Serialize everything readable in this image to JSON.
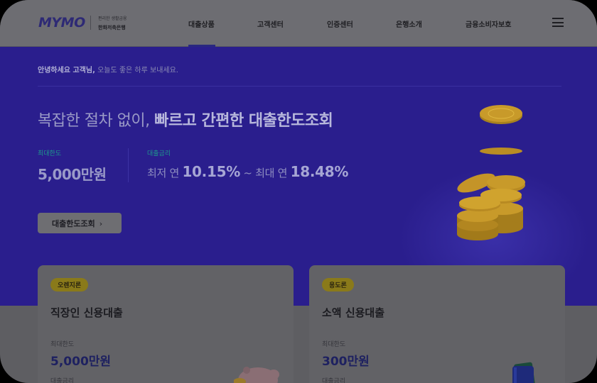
{
  "brand": {
    "logo": "MYMO",
    "sub_line1": "편리한 생활금융",
    "sub_line2": "한화저축은행"
  },
  "nav": {
    "items": [
      "대출상품",
      "고객센터",
      "인증센터",
      "은행소개",
      "금융소비자보호"
    ],
    "active": "대출상품"
  },
  "hero": {
    "greeting_name": "안녕하세요 고객님,",
    "greeting_rest": " 오늘도 좋은 하루 보내세요.",
    "headline_plain": "복잡한 절차 없이, ",
    "headline_bold": "빠르고 간편한 대출한도조회",
    "max_limit_label": "최대한도",
    "max_limit_value": "5,000만원",
    "rate_label": "대출금리",
    "rate_min_prefix": "최저 연 ",
    "rate_min": "10.15%",
    "rate_sep": " ~ ",
    "rate_max_prefix": "최대 연 ",
    "rate_max": "18.48%",
    "cta_label": "대출한도조회",
    "cta_chevron": "›"
  },
  "cards": [
    {
      "badge": "오렌지론",
      "title": "직장인 신용대출",
      "limit_label": "최대한도",
      "limit_value": "5,000만원",
      "rate_label": "대출금리",
      "icon": "piggy-bank-icon"
    },
    {
      "badge": "용도론",
      "title": "소액 신용대출",
      "limit_label": "최대한도",
      "limit_value": "300만원",
      "rate_label": "대출금리",
      "icon": "wallet-icon"
    }
  ],
  "colors": {
    "hero_bg": "#2a1e8d",
    "accent_teal": "#1d9a8c",
    "coin_gold": "#c89a2a",
    "badge_bg": "#8a7a1a"
  }
}
